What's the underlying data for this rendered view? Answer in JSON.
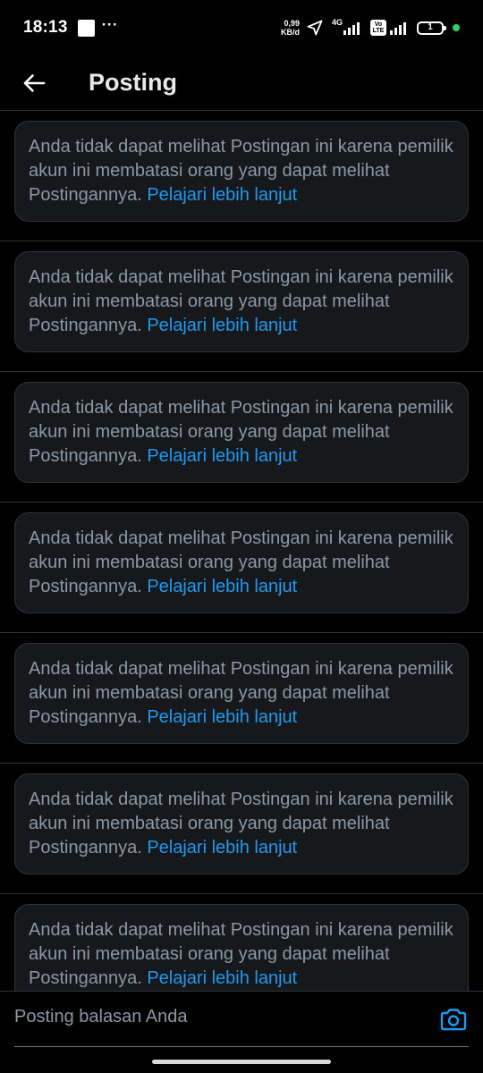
{
  "status_bar": {
    "time": "18:13",
    "more_indicator": "···",
    "net_speed_value": "0,99",
    "net_speed_unit": "KB/d",
    "network_type": "4G",
    "volte_top": "Vo",
    "volte_bottom": "LTE",
    "battery_level": "1",
    "dot_color": "#2fd16b"
  },
  "header": {
    "back_icon": "arrow-left-icon",
    "title": "Posting"
  },
  "posts": [
    {
      "notice": "Anda tidak dapat melihat Postingan ini karena pemilik akun ini membatasi orang yang dapat melihat Postingannya.",
      "link": "Pelajari lebih lanjut"
    },
    {
      "notice": "Anda tidak dapat melihat Postingan ini karena pemilik akun ini membatasi orang yang dapat melihat Postingannya.",
      "link": "Pelajari lebih lanjut"
    },
    {
      "notice": "Anda tidak dapat melihat Postingan ini karena pemilik akun ini membatasi orang yang dapat melihat Postingannya.",
      "link": "Pelajari lebih lanjut"
    },
    {
      "notice": "Anda tidak dapat melihat Postingan ini karena pemilik akun ini membatasi orang yang dapat melihat Postingannya.",
      "link": "Pelajari lebih lanjut"
    },
    {
      "notice": "Anda tidak dapat melihat Postingan ini karena pemilik akun ini membatasi orang yang dapat melihat Postingannya.",
      "link": "Pelajari lebih lanjut"
    },
    {
      "notice": "Anda tidak dapat melihat Postingan ini karena pemilik akun ini membatasi orang yang dapat melihat Postingannya.",
      "link": "Pelajari lebih lanjut"
    },
    {
      "notice": "Anda tidak dapat melihat Postingan ini karena pemilik akun ini membatasi orang yang dapat melihat Postingannya.",
      "link": "Pelajari lebih lanjut"
    }
  ],
  "reply_bar": {
    "placeholder": "Posting balasan Anda",
    "value": "",
    "camera_icon": "camera-icon"
  },
  "colors": {
    "background": "#000000",
    "card_background": "#16181c",
    "border": "#2f3336",
    "secondary_text": "#8b98a5",
    "link": "#1d9bf0"
  }
}
